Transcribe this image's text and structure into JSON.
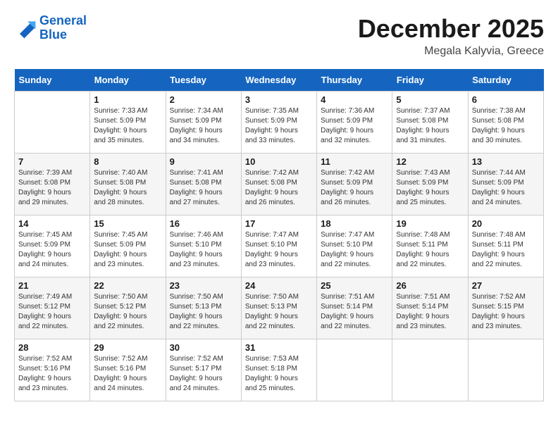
{
  "logo": {
    "line1": "General",
    "line2": "Blue"
  },
  "title": "December 2025",
  "location": "Megala Kalyvia, Greece",
  "days_of_week": [
    "Sunday",
    "Monday",
    "Tuesday",
    "Wednesday",
    "Thursday",
    "Friday",
    "Saturday"
  ],
  "weeks": [
    [
      {
        "day": "",
        "info": ""
      },
      {
        "day": "1",
        "info": "Sunrise: 7:33 AM\nSunset: 5:09 PM\nDaylight: 9 hours\nand 35 minutes."
      },
      {
        "day": "2",
        "info": "Sunrise: 7:34 AM\nSunset: 5:09 PM\nDaylight: 9 hours\nand 34 minutes."
      },
      {
        "day": "3",
        "info": "Sunrise: 7:35 AM\nSunset: 5:09 PM\nDaylight: 9 hours\nand 33 minutes."
      },
      {
        "day": "4",
        "info": "Sunrise: 7:36 AM\nSunset: 5:09 PM\nDaylight: 9 hours\nand 32 minutes."
      },
      {
        "day": "5",
        "info": "Sunrise: 7:37 AM\nSunset: 5:08 PM\nDaylight: 9 hours\nand 31 minutes."
      },
      {
        "day": "6",
        "info": "Sunrise: 7:38 AM\nSunset: 5:08 PM\nDaylight: 9 hours\nand 30 minutes."
      }
    ],
    [
      {
        "day": "7",
        "info": "Sunrise: 7:39 AM\nSunset: 5:08 PM\nDaylight: 9 hours\nand 29 minutes."
      },
      {
        "day": "8",
        "info": "Sunrise: 7:40 AM\nSunset: 5:08 PM\nDaylight: 9 hours\nand 28 minutes."
      },
      {
        "day": "9",
        "info": "Sunrise: 7:41 AM\nSunset: 5:08 PM\nDaylight: 9 hours\nand 27 minutes."
      },
      {
        "day": "10",
        "info": "Sunrise: 7:42 AM\nSunset: 5:08 PM\nDaylight: 9 hours\nand 26 minutes."
      },
      {
        "day": "11",
        "info": "Sunrise: 7:42 AM\nSunset: 5:09 PM\nDaylight: 9 hours\nand 26 minutes."
      },
      {
        "day": "12",
        "info": "Sunrise: 7:43 AM\nSunset: 5:09 PM\nDaylight: 9 hours\nand 25 minutes."
      },
      {
        "day": "13",
        "info": "Sunrise: 7:44 AM\nSunset: 5:09 PM\nDaylight: 9 hours\nand 24 minutes."
      }
    ],
    [
      {
        "day": "14",
        "info": "Sunrise: 7:45 AM\nSunset: 5:09 PM\nDaylight: 9 hours\nand 24 minutes."
      },
      {
        "day": "15",
        "info": "Sunrise: 7:45 AM\nSunset: 5:09 PM\nDaylight: 9 hours\nand 23 minutes."
      },
      {
        "day": "16",
        "info": "Sunrise: 7:46 AM\nSunset: 5:10 PM\nDaylight: 9 hours\nand 23 minutes."
      },
      {
        "day": "17",
        "info": "Sunrise: 7:47 AM\nSunset: 5:10 PM\nDaylight: 9 hours\nand 23 minutes."
      },
      {
        "day": "18",
        "info": "Sunrise: 7:47 AM\nSunset: 5:10 PM\nDaylight: 9 hours\nand 22 minutes."
      },
      {
        "day": "19",
        "info": "Sunrise: 7:48 AM\nSunset: 5:11 PM\nDaylight: 9 hours\nand 22 minutes."
      },
      {
        "day": "20",
        "info": "Sunrise: 7:48 AM\nSunset: 5:11 PM\nDaylight: 9 hours\nand 22 minutes."
      }
    ],
    [
      {
        "day": "21",
        "info": "Sunrise: 7:49 AM\nSunset: 5:12 PM\nDaylight: 9 hours\nand 22 minutes."
      },
      {
        "day": "22",
        "info": "Sunrise: 7:50 AM\nSunset: 5:12 PM\nDaylight: 9 hours\nand 22 minutes."
      },
      {
        "day": "23",
        "info": "Sunrise: 7:50 AM\nSunset: 5:13 PM\nDaylight: 9 hours\nand 22 minutes."
      },
      {
        "day": "24",
        "info": "Sunrise: 7:50 AM\nSunset: 5:13 PM\nDaylight: 9 hours\nand 22 minutes."
      },
      {
        "day": "25",
        "info": "Sunrise: 7:51 AM\nSunset: 5:14 PM\nDaylight: 9 hours\nand 22 minutes."
      },
      {
        "day": "26",
        "info": "Sunrise: 7:51 AM\nSunset: 5:14 PM\nDaylight: 9 hours\nand 23 minutes."
      },
      {
        "day": "27",
        "info": "Sunrise: 7:52 AM\nSunset: 5:15 PM\nDaylight: 9 hours\nand 23 minutes."
      }
    ],
    [
      {
        "day": "28",
        "info": "Sunrise: 7:52 AM\nSunset: 5:16 PM\nDaylight: 9 hours\nand 23 minutes."
      },
      {
        "day": "29",
        "info": "Sunrise: 7:52 AM\nSunset: 5:16 PM\nDaylight: 9 hours\nand 24 minutes."
      },
      {
        "day": "30",
        "info": "Sunrise: 7:52 AM\nSunset: 5:17 PM\nDaylight: 9 hours\nand 24 minutes."
      },
      {
        "day": "31",
        "info": "Sunrise: 7:53 AM\nSunset: 5:18 PM\nDaylight: 9 hours\nand 25 minutes."
      },
      {
        "day": "",
        "info": ""
      },
      {
        "day": "",
        "info": ""
      },
      {
        "day": "",
        "info": ""
      }
    ]
  ]
}
